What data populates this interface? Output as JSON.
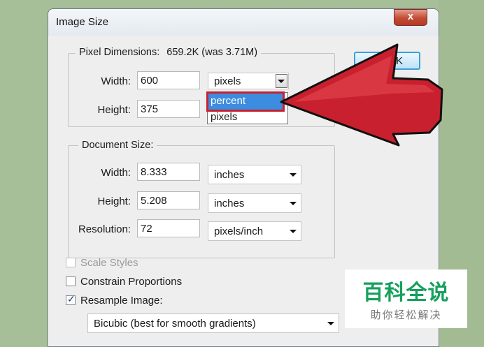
{
  "window": {
    "title": "Image Size",
    "close_symbol": "x"
  },
  "pixel_dimensions": {
    "legend": "Pixel Dimensions:",
    "size_text": "659.2K (was 3.71M)",
    "width_label": "Width:",
    "width_value": "600",
    "width_unit": "pixels",
    "height_label": "Height:",
    "height_value": "375",
    "unit_options": [
      "percent",
      "pixels"
    ],
    "highlighted_option": "percent"
  },
  "document_size": {
    "legend": "Document Size:",
    "width_label": "Width:",
    "width_value": "8.333",
    "width_unit": "inches",
    "height_label": "Height:",
    "height_value": "5.208",
    "height_unit": "inches",
    "resolution_label": "Resolution:",
    "resolution_value": "72",
    "resolution_unit": "pixels/inch"
  },
  "buttons": {
    "ok_partial": "K",
    "auto_partial": "..."
  },
  "options": {
    "scale_styles": {
      "label": "Scale Styles",
      "checked": false,
      "enabled": false
    },
    "constrain_proportions": {
      "label": "Constrain Proportions",
      "checked": false
    },
    "resample_image": {
      "label": "Resample Image:",
      "checked": true
    },
    "resample_method": "Bicubic (best for smooth gradients)"
  },
  "watermark": {
    "title": "百科全说",
    "subtitle": "助你轻松解决"
  },
  "annotation": {
    "arrow_color": "#c8202e",
    "arrow_outline": "#111111"
  },
  "colors": {
    "background": "#a7bf98",
    "highlight": "#3c8ce0",
    "watermark_green": "#15a05d"
  }
}
